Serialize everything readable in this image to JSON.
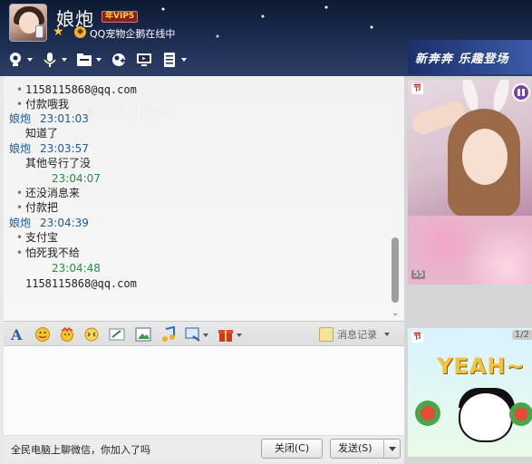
{
  "header": {
    "username": "娘炮",
    "vip_badge": "年VIP5",
    "status_text": "QQ宠物企鹅在线中",
    "toolbar": [
      {
        "name": "video-call",
        "icon": "camera-icon"
      },
      {
        "name": "voice-call",
        "icon": "microphone-icon"
      },
      {
        "name": "file-transfer",
        "icon": "folder-icon"
      },
      {
        "name": "add-contact",
        "icon": "add-user-icon"
      },
      {
        "name": "screen-share",
        "icon": "monitor-icon"
      },
      {
        "name": "more-apps",
        "icon": "list-icon"
      }
    ]
  },
  "ad_top": {
    "text": "新奔奔 乐趣登场"
  },
  "chat": {
    "watermark": "e old days.",
    "messages": [
      {
        "type": "bullet",
        "text": "1158115868@qq.com",
        "mono": true
      },
      {
        "type": "bullet",
        "text": "付款哦我"
      },
      {
        "type": "sender",
        "name": "娘炮",
        "time": "23:01:03"
      },
      {
        "type": "text",
        "text": "知道了"
      },
      {
        "type": "sender",
        "name": "娘炮",
        "time": "23:03:57"
      },
      {
        "type": "text",
        "text": "其他号行了没"
      },
      {
        "type": "timestamp",
        "time": "23:04:07"
      },
      {
        "type": "bullet",
        "text": "还没消息来"
      },
      {
        "type": "bullet",
        "text": "付款把"
      },
      {
        "type": "sender",
        "name": "娘炮",
        "time": "23:04:39"
      },
      {
        "type": "bullet",
        "text": "支付宝"
      },
      {
        "type": "bullet",
        "text": "怕死我不给"
      },
      {
        "type": "timestamp",
        "time": "23:04:48"
      },
      {
        "type": "text",
        "text": "1158115868@qq.com",
        "mono": true
      }
    ]
  },
  "input_toolbar": {
    "icons": [
      "font-icon",
      "emoji-icon",
      "magic-face-icon",
      "shake-icon",
      "doodle-icon",
      "image-icon",
      "music-icon",
      "screenshot-icon",
      "gift-icon"
    ],
    "history_label": "消息记录"
  },
  "bottom_bar": {
    "ticker": "全民电脑上聊微信，你加入了吗",
    "close_label": "关闭(C)",
    "send_label": "发送(S)"
  },
  "side": {
    "photo_tag": "节",
    "photo_thumbs": "55",
    "cartoon_tag": "节",
    "cartoon_pager": "1/2",
    "cartoon_text": "YEAH~"
  }
}
